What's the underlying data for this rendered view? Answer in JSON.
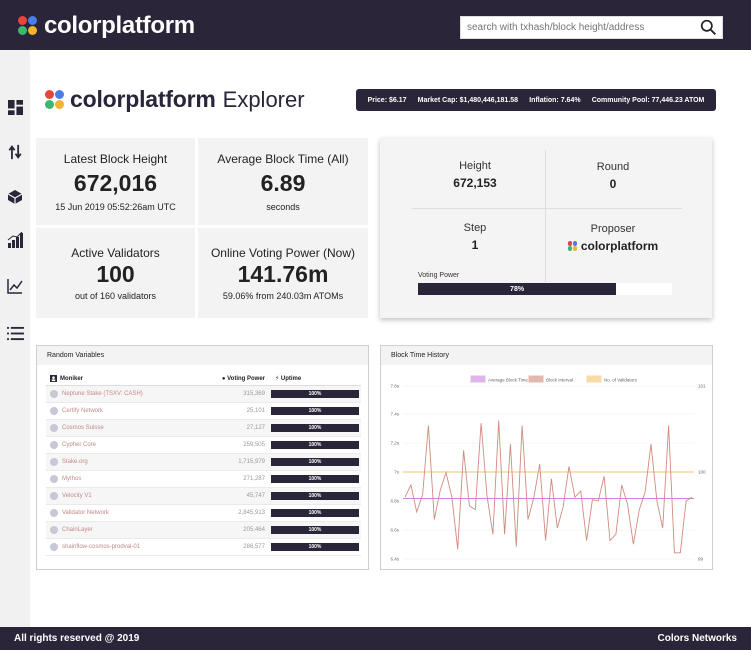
{
  "topbar": {
    "brand": "colorplatform",
    "search_placeholder": "search with txhash/block height/address"
  },
  "sidebar": {
    "items": [
      {
        "icon": "dashboard-icon"
      },
      {
        "icon": "transactions-icon"
      },
      {
        "icon": "validators-icon"
      },
      {
        "icon": "stats-icon"
      },
      {
        "icon": "chart-icon"
      },
      {
        "icon": "list-icon"
      }
    ]
  },
  "header": {
    "brand": "colorplatform",
    "title": "Explorer"
  },
  "ticker": {
    "price": "Price: $6.17",
    "market_cap": "Market Cap: $1,480,446,181.58",
    "inflation": "Inflation: 7.64%",
    "community_pool": "Community Pool: 77,446.23 ATOM"
  },
  "stats": {
    "block_height": {
      "label": "Latest Block Height",
      "value": "672,016",
      "sub": "15 Jun 2019 05:52:26am UTC"
    },
    "block_time": {
      "label": "Average Block Time (All)",
      "value": "6.89",
      "sub": "seconds"
    },
    "validators": {
      "label": "Active Validators",
      "value": "100",
      "sub": "out of 160 validators"
    },
    "voting_power": {
      "label": "Online Voting Power (Now)",
      "value": "141.76m",
      "sub": "59.06% from 240.03m ATOMs"
    }
  },
  "consensus": {
    "height_label": "Height",
    "height": "672,153",
    "round_label": "Round",
    "round": "0",
    "step_label": "Step",
    "step": "1",
    "proposer_label": "Proposer",
    "proposer": "colorplatform",
    "voting_power_label": "Voting Power",
    "voting_power_pct": "78%",
    "voting_power_fraction": 0.78
  },
  "validators_panel": {
    "title": "Random Variables",
    "col_moniker": "Moniker",
    "col_voting_power": "Voting Power",
    "col_uptime": "Uptime",
    "rows": [
      {
        "moniker": "Neptune Stake (TSXV: CASH)",
        "vp": "315,369",
        "uptime": "100%"
      },
      {
        "moniker": "Certify Network",
        "vp": "25,101",
        "uptime": "100%"
      },
      {
        "moniker": "Cosmos Suisse",
        "vp": "27,127",
        "uptime": "100%"
      },
      {
        "moniker": "Cypher Core",
        "vp": "259,505",
        "uptime": "100%"
      },
      {
        "moniker": "Stake.org",
        "vp": "1,715,979",
        "uptime": "100%"
      },
      {
        "moniker": "Mythos",
        "vp": "271,287",
        "uptime": "100%"
      },
      {
        "moniker": "Velocity V1",
        "vp": "45,747",
        "uptime": "100%"
      },
      {
        "moniker": "Validator Network",
        "vp": "2,845,913",
        "uptime": "100%"
      },
      {
        "moniker": "ChainLayer",
        "vp": "205,464",
        "uptime": "100%"
      },
      {
        "moniker": "shainflow-cosmos-prodval-01",
        "vp": "286,577",
        "uptime": "100%"
      }
    ]
  },
  "chart_panel": {
    "title": "Block Time History"
  },
  "chart_data": {
    "type": "line",
    "title": "",
    "legend": [
      "Average Block Time",
      "Block Interval",
      "No. of Validators"
    ],
    "legend_position": "top",
    "y_left_ticks": [
      "7.8s",
      "7.4s",
      "7.2s",
      "7s",
      "6.8s",
      "6.6s",
      "6.4s"
    ],
    "y_right_ticks": [
      "101",
      "100",
      "99"
    ],
    "ylim": [
      6.4,
      7.8
    ],
    "series": [
      {
        "name": "Average Block Time",
        "color": "#c987d8",
        "values": [
          6.89,
          6.89,
          6.89,
          6.89,
          6.89,
          6.89,
          6.89,
          6.89,
          6.89,
          6.89,
          6.89,
          6.89,
          6.89,
          6.89,
          6.89,
          6.89,
          6.89,
          6.89,
          6.89,
          6.89,
          6.89,
          6.89,
          6.89,
          6.89,
          6.89,
          6.89,
          6.89,
          6.89,
          6.89,
          6.89,
          6.89,
          6.89,
          6.89,
          6.89,
          6.89,
          6.89,
          6.89,
          6.89,
          6.89,
          6.89,
          6.89,
          6.89,
          6.89,
          6.89,
          6.89,
          6.89,
          6.89,
          6.89,
          6.89,
          6.89
        ]
      },
      {
        "name": "Block Interval",
        "color": "#d28a7e",
        "values": [
          6.9,
          7.0,
          6.78,
          6.92,
          7.48,
          6.72,
          6.95,
          7.1,
          6.9,
          6.48,
          7.28,
          6.83,
          6.8,
          7.5,
          6.91,
          6.6,
          7.52,
          6.6,
          7.33,
          6.5,
          7.48,
          6.72,
          6.9,
          7.17,
          6.55,
          7.05,
          6.65,
          6.82,
          7.15,
          6.9,
          6.95,
          6.55,
          6.88,
          6.87,
          7.07,
          6.55,
          6.6,
          7.0,
          6.84,
          6.52,
          6.8,
          6.94,
          7.33,
          6.87,
          6.65,
          7.48,
          6.45,
          6.45,
          6.87,
          6.9
        ]
      },
      {
        "name": "No. of Validators",
        "color": "#f3c46f",
        "values": [
          100,
          100,
          100,
          100,
          100,
          100,
          100,
          100,
          100,
          100,
          100,
          100,
          100,
          100,
          100,
          100,
          100,
          100,
          100,
          100,
          100,
          100,
          100,
          100,
          100,
          100,
          100,
          100,
          100,
          100,
          100,
          100,
          100,
          100,
          100,
          100,
          100,
          100,
          100,
          100,
          100,
          100,
          100,
          100,
          100,
          100,
          100,
          100,
          100,
          100
        ]
      }
    ]
  },
  "footer": {
    "left": "All rights reserved @ 2019",
    "right": "Colors Networks"
  }
}
